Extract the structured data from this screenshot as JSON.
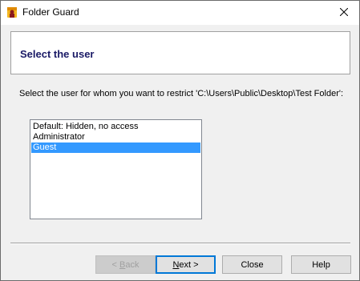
{
  "window": {
    "title": "Folder Guard",
    "icon": "folder-guard-app-icon",
    "close_icon": "close-icon"
  },
  "header": {
    "title": "Select the user"
  },
  "instruction": "Select the user for whom you want to restrict 'C:\\Users\\Public\\Desktop\\Test Folder':",
  "users": {
    "items": [
      {
        "label": "Default: Hidden, no access",
        "selected": false
      },
      {
        "label": "Administrator",
        "selected": false
      },
      {
        "label": "Guest",
        "selected": true
      }
    ]
  },
  "buttons": {
    "back": {
      "prefix": "< ",
      "mnemonic": "B",
      "suffix": "ack",
      "enabled": false
    },
    "next": {
      "mnemonic": "N",
      "suffix": "ext >",
      "enabled": true,
      "default": true
    },
    "close": {
      "label": "Close",
      "enabled": true
    },
    "help": {
      "label": "Help",
      "enabled": true
    }
  },
  "colors": {
    "header_title": "#1a1a66",
    "selection": "#3399ff",
    "default_button_border": "#0078d7"
  }
}
